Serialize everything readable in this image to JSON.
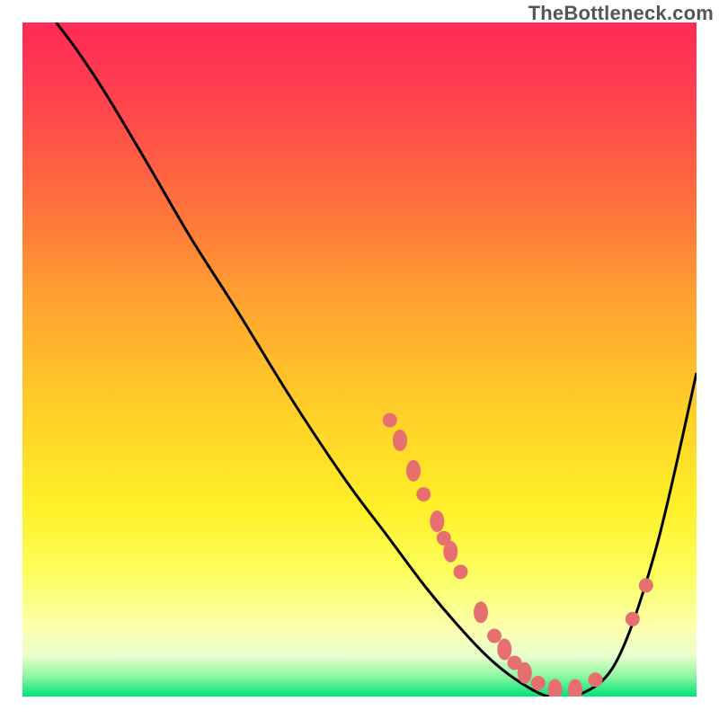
{
  "watermark": "TheBottleneck.com",
  "chart_data": {
    "type": "line",
    "title": "",
    "xlabel": "",
    "ylabel": "",
    "xlim": [
      0,
      100
    ],
    "ylim": [
      0,
      100
    ],
    "grid": false,
    "series": [
      {
        "name": "curve",
        "x": [
          5,
          8,
          12,
          18,
          25,
          32,
          40,
          48,
          54,
          60,
          66,
          70,
          74,
          78,
          82,
          88,
          94,
          100
        ],
        "y": [
          100,
          96,
          90,
          80,
          68,
          57,
          44,
          32,
          24,
          16,
          9,
          5,
          2,
          0,
          0,
          5,
          22,
          48
        ]
      }
    ],
    "markers": [
      {
        "x": 54.5,
        "y": 41.0,
        "shape": "circle"
      },
      {
        "x": 56.0,
        "y": 38.0,
        "shape": "oval"
      },
      {
        "x": 58.0,
        "y": 33.5,
        "shape": "oval"
      },
      {
        "x": 59.5,
        "y": 30.0,
        "shape": "circle"
      },
      {
        "x": 61.5,
        "y": 26.0,
        "shape": "oval"
      },
      {
        "x": 62.5,
        "y": 23.5,
        "shape": "circle"
      },
      {
        "x": 63.5,
        "y": 21.5,
        "shape": "oval"
      },
      {
        "x": 65.0,
        "y": 18.5,
        "shape": "circle"
      },
      {
        "x": 68.0,
        "y": 12.5,
        "shape": "oval"
      },
      {
        "x": 70.0,
        "y": 9.0,
        "shape": "circle"
      },
      {
        "x": 71.5,
        "y": 7.0,
        "shape": "oval"
      },
      {
        "x": 73.0,
        "y": 5.0,
        "shape": "circle"
      },
      {
        "x": 74.5,
        "y": 3.5,
        "shape": "oval"
      },
      {
        "x": 76.5,
        "y": 2.0,
        "shape": "circle"
      },
      {
        "x": 79.0,
        "y": 1.0,
        "shape": "oval"
      },
      {
        "x": 82.0,
        "y": 1.0,
        "shape": "oval"
      },
      {
        "x": 85.0,
        "y": 2.5,
        "shape": "circle"
      },
      {
        "x": 90.5,
        "y": 11.5,
        "shape": "circle"
      },
      {
        "x": 92.5,
        "y": 16.5,
        "shape": "circle"
      }
    ],
    "legend": false
  },
  "colors": {
    "curve": "#000000",
    "marker": "#e86f6f",
    "gradient_top": "#ff2a55",
    "gradient_bottom": "#00e27a"
  }
}
